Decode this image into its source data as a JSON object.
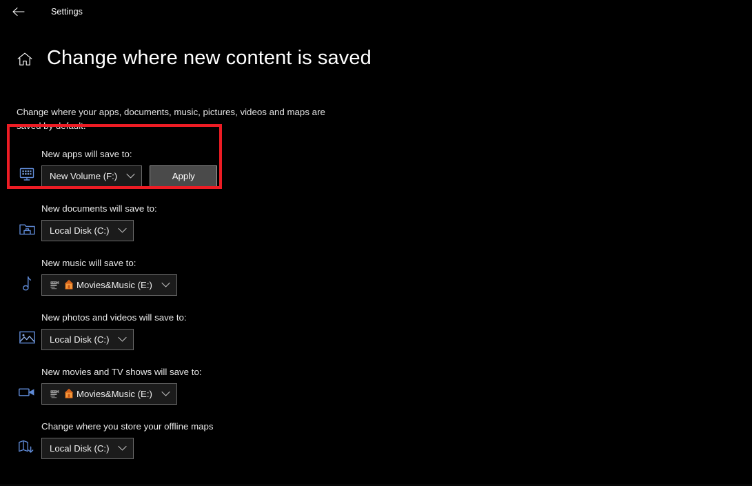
{
  "titlebar": {
    "back_icon": "back-arrow-icon",
    "app_title": "Settings"
  },
  "header": {
    "home_icon": "home-icon",
    "page_title": "Change where new content is saved"
  },
  "description": "Change where your apps, documents, music, pictures, videos and maps are saved by default.",
  "highlight": {
    "color": "#ed1c24",
    "target": "new-apps-save-to-row"
  },
  "settings": [
    {
      "id": "apps",
      "icon": "monitor-apps-icon",
      "label": "New apps will save to:",
      "dropdown": {
        "value": "New Volume (F:)",
        "pre_icons": []
      },
      "button": "Apply"
    },
    {
      "id": "documents",
      "icon": "folder-documents-icon",
      "label": "New documents will save to:",
      "dropdown": {
        "value": "Local Disk (C:)",
        "pre_icons": []
      },
      "button": null
    },
    {
      "id": "music",
      "icon": "music-note-icon",
      "label": "New music will save to:",
      "dropdown": {
        "value": "Movies&Music (E:)",
        "pre_icons": [
          "film-drive-icon",
          "orange-house-icon"
        ]
      },
      "button": null
    },
    {
      "id": "photos",
      "icon": "picture-icon",
      "label": "New photos and videos will save to:",
      "dropdown": {
        "value": "Local Disk (C:)",
        "pre_icons": []
      },
      "button": null
    },
    {
      "id": "movies",
      "icon": "video-camera-icon",
      "label": "New movies and TV shows will save to:",
      "dropdown": {
        "value": "Movies&Music (E:)",
        "pre_icons": [
          "film-drive-icon",
          "orange-house-icon"
        ]
      },
      "button": null
    },
    {
      "id": "maps",
      "icon": "offline-map-icon",
      "label": "Change where you store your offline maps",
      "dropdown": {
        "value": "Local Disk (C:)",
        "pre_icons": []
      },
      "button": null
    }
  ],
  "colors": {
    "accent_blue": "#4a78c8",
    "highlight_red": "#ed1c24",
    "background": "#000000",
    "dropdown_border": "#6b6b6b",
    "button_fill": "#4a4a4a"
  }
}
